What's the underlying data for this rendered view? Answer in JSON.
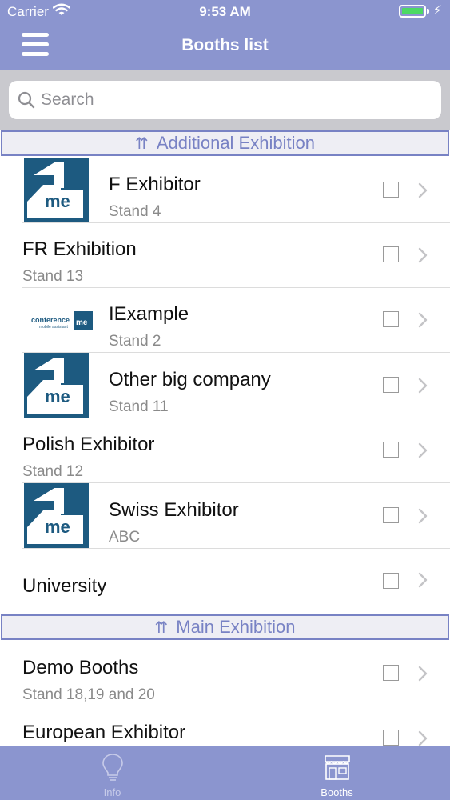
{
  "status_bar": {
    "carrier": "Carrier",
    "time": "9:53 AM",
    "battery_level": 1.0
  },
  "header": {
    "title": "Booths list",
    "menu_icon": "hamburger-icon"
  },
  "search": {
    "placeholder": "Search",
    "value": ""
  },
  "sections": [
    {
      "arrows": "⇈",
      "title": "Additional Exhibition"
    },
    {
      "arrows": "⇈",
      "title": "Main Exhibition"
    }
  ],
  "booths": [
    {
      "name": "F Exhibitor",
      "stand": "Stand 4",
      "logo": "1me-logo",
      "selected": false
    },
    {
      "name": "FR Exhibition",
      "stand": "Stand 13",
      "logo": "",
      "selected": false
    },
    {
      "name": "IExample",
      "stand": "Stand 2",
      "logo": "conference4me-logo",
      "selected": false
    },
    {
      "name": "Other big company",
      "stand": "Stand 11",
      "logo": "1me-logo",
      "selected": false
    },
    {
      "name": "Polish Exhibitor",
      "stand": "Stand 12",
      "logo": "",
      "selected": false
    },
    {
      "name": "Swiss Exhibitor",
      "stand": "ABC",
      "logo": "1me-logo",
      "selected": false
    },
    {
      "name": "University",
      "stand": "",
      "logo": "",
      "selected": false
    },
    {
      "name": "Demo Booths",
      "stand": "Stand 18,19 and 20",
      "logo": "",
      "selected": false
    },
    {
      "name": "European Exhibitor",
      "stand": "",
      "logo": "",
      "selected": false
    }
  ],
  "logo_text": {
    "big": "me",
    "small_word": "conference",
    "small_tag": "mobile assistant",
    "small_badge": "me"
  },
  "tabs": [
    {
      "label": "Info",
      "icon": "lightbulb-icon",
      "active": false
    },
    {
      "label": "Booths",
      "icon": "booth-icon",
      "active": true
    }
  ],
  "colors": {
    "accent": "#8b95cf",
    "section": "#7882c4",
    "logo": "#1d5a80"
  }
}
